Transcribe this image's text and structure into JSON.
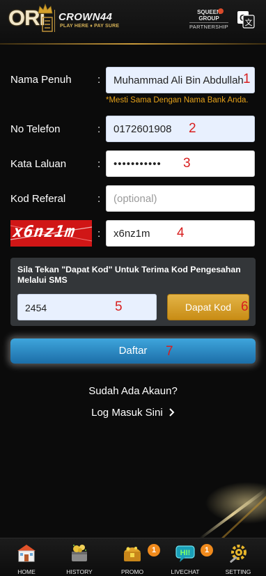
{
  "header": {
    "logo_main": "ORi",
    "logo_brand": "CROWN44",
    "logo_tagline": "PLAY HERE ♦ PAY SURE",
    "partner_line1": "SQUEEN",
    "partner_line2": "GROUP",
    "partner_line3": "PARTNERSHIP",
    "translate_icon": "google-translate-icon"
  },
  "form": {
    "full_name": {
      "label": "Nama Penuh",
      "colon": ":",
      "value": "Muhammad Ali Bin Abdullah",
      "marker": "1"
    },
    "name_hint": "*Mesti Sama Dengan Nama Bank Anda.",
    "phone": {
      "label": "No Telefon",
      "colon": ":",
      "value": "0172601908",
      "marker": "2"
    },
    "password": {
      "label": "Kata Laluan",
      "colon": ":",
      "value": "•••••••••••",
      "marker": "3"
    },
    "referral": {
      "label": "Kod Referal",
      "colon": ":",
      "placeholder": "(optional)"
    },
    "captcha": {
      "image_text": "x6nz1m",
      "colon": ":",
      "value": "x6nz1m",
      "marker": "4"
    }
  },
  "sms": {
    "instruction": "Sila Tekan \"Dapat Kod\" Untuk Terima Kod Pengesahan Melalui SMS",
    "code_value": "2454",
    "code_marker": "5",
    "get_code_label": "Dapat Kod",
    "get_code_marker": "6"
  },
  "submit": {
    "label": "Daftar",
    "marker": "7"
  },
  "login": {
    "question": "Sudah Ada Akaun?",
    "link": "Log Masuk Sini",
    "link_icon": "chevron-right-icon"
  },
  "nav": [
    {
      "label": "HOME",
      "icon": "home-icon"
    },
    {
      "label": "HISTORY",
      "icon": "history-icon"
    },
    {
      "label": "PROMO",
      "icon": "promo-icon",
      "badge": "1"
    },
    {
      "label": "LIVECHAT",
      "icon": "livechat-icon",
      "badge": "1"
    },
    {
      "label": "SETTING",
      "icon": "setting-icon"
    }
  ],
  "colors": {
    "background": "#0b0b0b",
    "accent_gold": "#d4a02a",
    "button_blue": "#2a8ac6",
    "hint_orange": "#e6a21a",
    "marker_red": "#d81e1e",
    "captcha_red": "#d01616"
  }
}
